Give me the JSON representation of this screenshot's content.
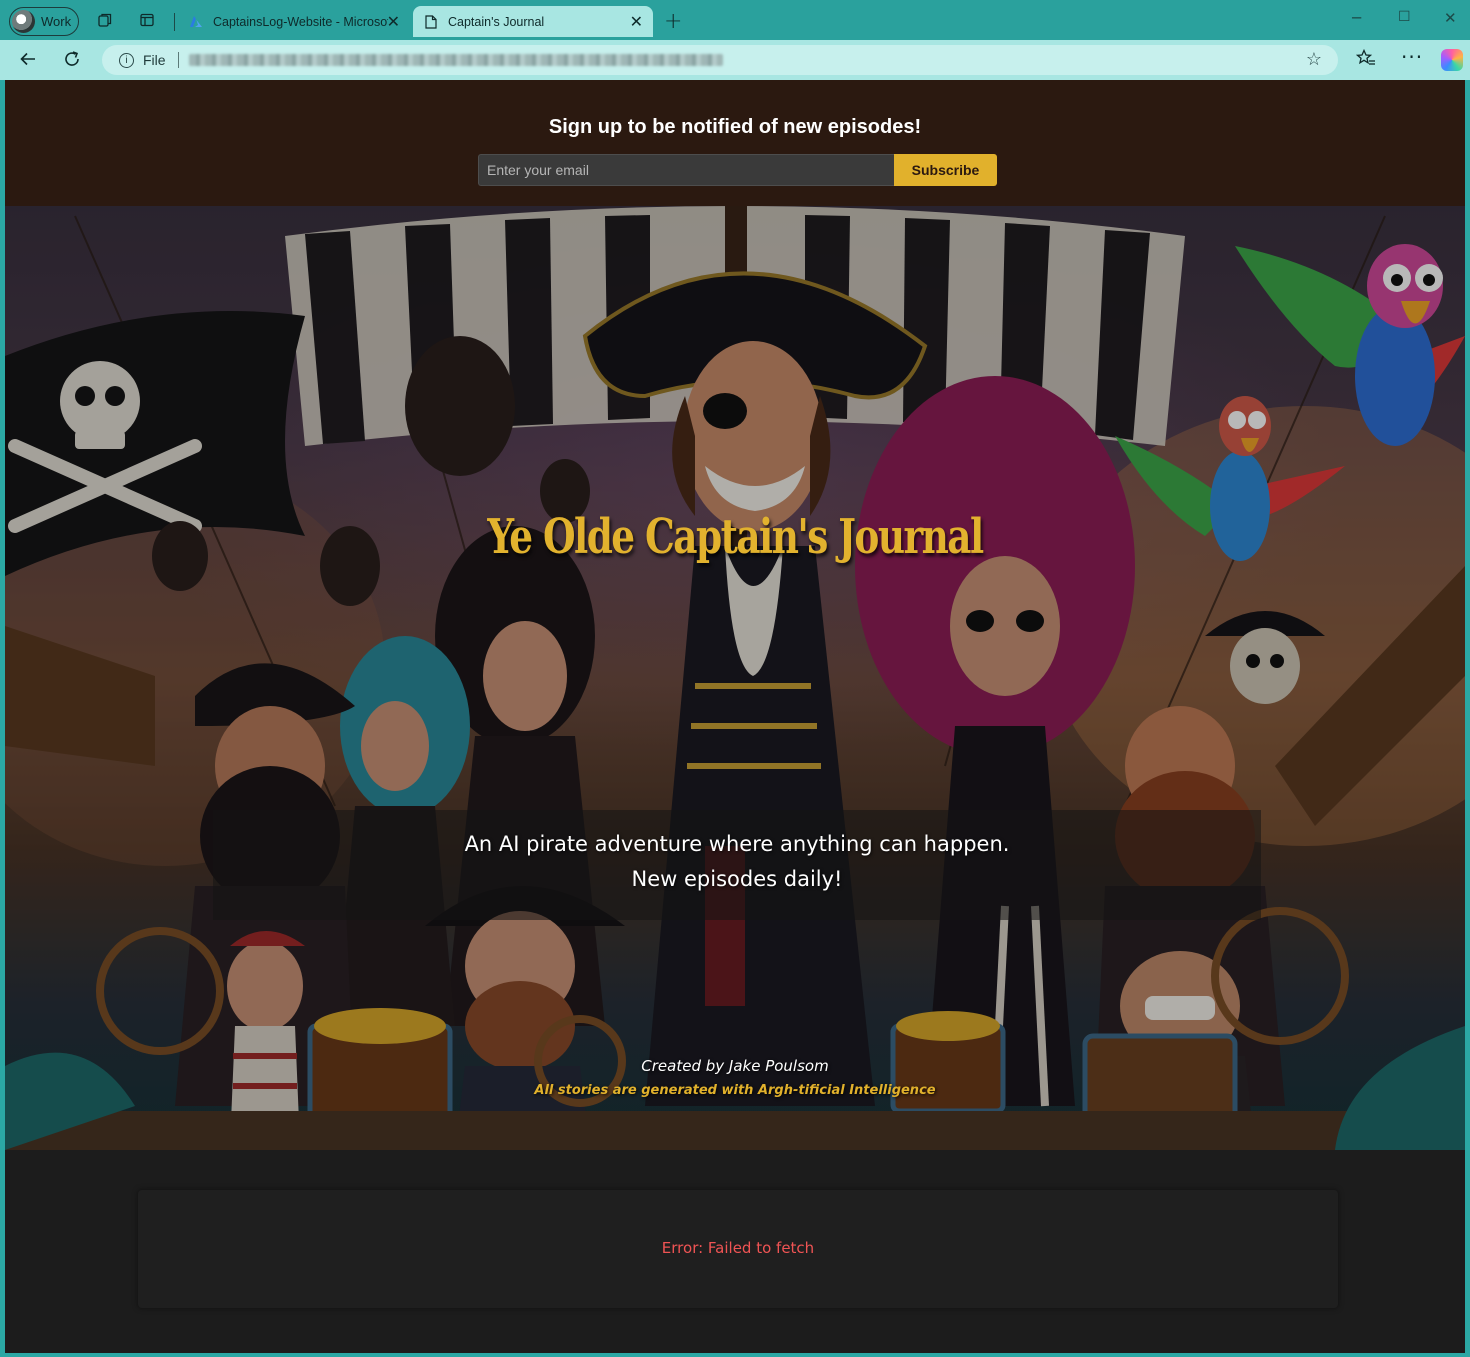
{
  "browser": {
    "profile_label": "Work",
    "tabs": [
      {
        "title": "CaptainsLog-Website - Microsoft",
        "active": false
      },
      {
        "title": "Captain's Journal",
        "active": true
      }
    ],
    "address": {
      "scheme_label": "File"
    },
    "icons": {
      "back": "back-arrow-icon",
      "reload": "reload-icon",
      "favorite": "star-icon",
      "favorites": "favorites-icon",
      "more": "more-icon"
    }
  },
  "signup": {
    "title": "Sign up to be notified of new episodes!",
    "email_placeholder": "Enter your email",
    "email_value": "",
    "subscribe_label": "Subscribe",
    "accent_color": "#e1b12c"
  },
  "hero": {
    "title": "Ye Olde Captain's Journal",
    "tagline_line1": "An AI pirate adventure where anything can happen.",
    "tagline_line2": "New episodes daily!",
    "creator": "Created by Jake Poulsom",
    "ai_note": "All stories are generated with Argh-tificial Intelligence"
  },
  "episodes": {
    "error": "Error: Failed to fetch",
    "error_color": "#f05454"
  }
}
